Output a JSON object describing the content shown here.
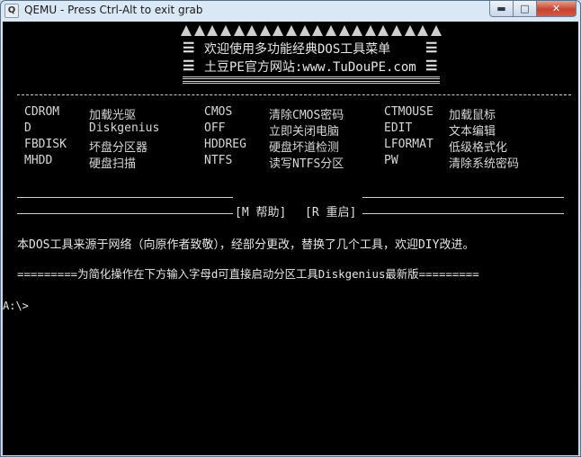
{
  "window": {
    "title": "QEMU - Press Ctrl-Alt to exit grab",
    "app_icon": "Q",
    "controls": {
      "minimize": "▬",
      "maximize": "□",
      "close": "✕"
    }
  },
  "header": {
    "line1": "欢迎使用多功能经典DOS工具菜单",
    "line2": "土豆PE官方网站:www.TuDouPE.com",
    "bar": "☰"
  },
  "menu": {
    "rows": [
      [
        {
          "cmd": "CDROM",
          "desc": "加载光驱"
        },
        {
          "cmd": "CMOS",
          "desc": "清除CMOS密码"
        },
        {
          "cmd": "CTMOUSE",
          "desc": "加载鼠标"
        }
      ],
      [
        {
          "cmd": "D",
          "desc": "Diskgenius"
        },
        {
          "cmd": "OFF",
          "desc": "立即关闭电脑"
        },
        {
          "cmd": "EDIT",
          "desc": "文本编辑"
        }
      ],
      [
        {
          "cmd": "FBDISK",
          "desc": "坏盘分区器"
        },
        {
          "cmd": "HDDREG",
          "desc": "硬盘坏道检测"
        },
        {
          "cmd": "LFORMAT",
          "desc": "低级格式化"
        }
      ],
      [
        {
          "cmd": "MHDD",
          "desc": "硬盘扫描"
        },
        {
          "cmd": "NTFS",
          "desc": "读写NTFS分区"
        },
        {
          "cmd": "PW",
          "desc": "清除系统密码"
        }
      ]
    ]
  },
  "footer": {
    "help_label": "[M 帮助]",
    "restart_label": "[R 重启]",
    "notice": "本DOS工具来源于网络（向原作者致敬），经部分更改，替换了几个工具，欢迎DIY改进。",
    "hint": "=========为简化操作在下方输入字母d可直接启动分区工具Diskgenius最新版========="
  },
  "console": {
    "prompt": "A:\\>"
  },
  "colors": {
    "screen_bg": "#000000",
    "text": "#d0d0d0",
    "titlebar": "#c4d6ea",
    "close_button": "#c7432f"
  }
}
